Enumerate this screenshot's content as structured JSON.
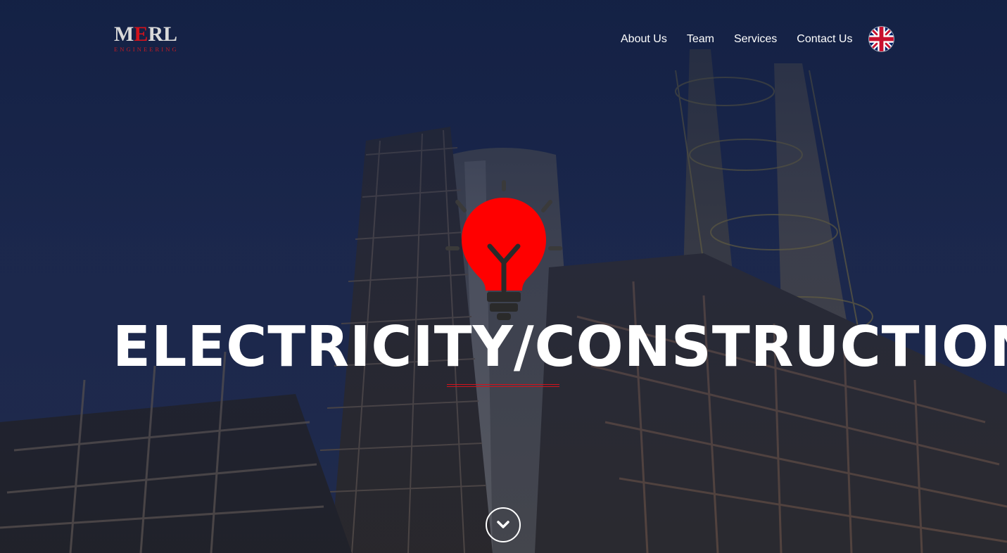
{
  "logo": {
    "mark_left": "M",
    "mark_e": "E",
    "mark_right": "RL",
    "subtitle": "ENGINEERING"
  },
  "nav": {
    "items": [
      {
        "label": "About Us"
      },
      {
        "label": "Team"
      },
      {
        "label": "Services"
      },
      {
        "label": "Contact Us"
      }
    ],
    "language_icon": "uk-flag-icon"
  },
  "hero": {
    "title": "ELECTRICITY/CONSTRUCTION",
    "icon": "lightbulb-icon",
    "scroll_icon": "chevron-down-icon"
  },
  "colors": {
    "accent": "#d1121c",
    "bulb": "#ff0000",
    "text": "#ffffff",
    "overlay": "#121e3e"
  }
}
